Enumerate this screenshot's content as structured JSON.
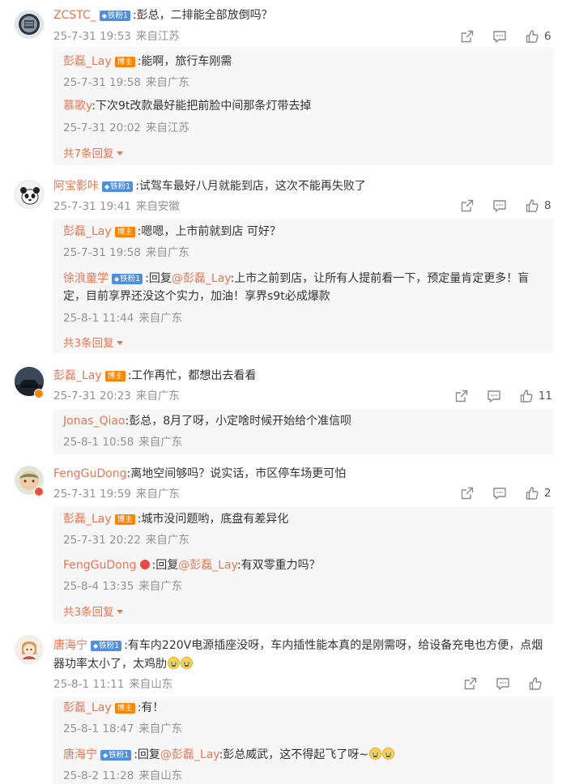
{
  "comments": [
    {
      "user": "ZCSTC_",
      "badge": "铁粉1",
      "text": ":彭总，二排能全部放倒吗？",
      "time": "25-7-31 19:53",
      "source": "来自江苏",
      "likes": "6",
      "replies": [
        {
          "user": "彭磊_Lay",
          "badge": "博主",
          "text": ":能啊，旅行车刚需",
          "time": "25-7-31 19:58",
          "source": "来自广东"
        },
        {
          "user": "慕歌y",
          "text": ":下次9t改款最好能把前脸中间那条灯带去掉",
          "time": "25-7-31 20:02",
          "source": "来自江苏"
        }
      ],
      "more": "共7条回复"
    },
    {
      "user": "阿宝影咔",
      "badge": "铁粉1",
      "text": ":试驾车最好八月就能到店，这次不能再失败了",
      "time": "25-7-31 19:41",
      "source": "来自安徽",
      "likes": "8",
      "replies": [
        {
          "user": "彭磊_Lay",
          "badge": "博主",
          "text": ":嗯嗯，上市前就到店 可好？",
          "time": "25-7-31 19:58",
          "source": "来自广东"
        },
        {
          "user": "徐浪童学",
          "badge": "铁粉1",
          "text_a": ":回复",
          "mention": "@彭磊_Lay",
          "text": ":上市之前到店，让所有人提前看一下，预定量肯定更多！盲定，目前享界还没这个实力，加油！享界s9t必成爆款",
          "time": "25-8-1 11:44",
          "source": "来自广东"
        }
      ],
      "more": "共3条回复"
    },
    {
      "user": "彭磊_Lay",
      "badge": "博主",
      "text": ":工作再忙，都想出去看看",
      "time": "25-7-31 20:23",
      "source": "来自广东",
      "likes": "11",
      "replies": [
        {
          "user": "Jonas_Qiao",
          "text": ":彭总，8月了呀，小定啥时候开始给个准信呗",
          "time": "25-8-1 10:58",
          "source": "来自广东"
        }
      ]
    },
    {
      "user": "FengGuDong",
      "text": ":离地空间够吗？说实话，市区停车场更可怕",
      "time": "25-7-31 19:59",
      "source": "来自广东",
      "likes": "2",
      "replies": [
        {
          "user": "彭磊_Lay",
          "badge": "博主",
          "text": ":城市没问题哟，底盘有差异化",
          "time": "25-7-31 20:22",
          "source": "来自广东"
        },
        {
          "user": "FengGuDong",
          "text_a": ":回复",
          "mention": "@彭磊_Lay",
          "text": ":有双零重力吗？",
          "time": "25-8-4 13:35",
          "source": "来自广东"
        }
      ],
      "more": "共3条回复"
    },
    {
      "user": "唐海宁",
      "badge": "铁粉1",
      "text": ":有车内220V电源插座没呀，车内插性能本真的是刚需呀，给设备充电也方便，点烟器功率太小了，太鸡肋",
      "time": "25-8-1 11:11",
      "source": "来自山东",
      "likes": "",
      "replies": [
        {
          "user": "彭磊_Lay",
          "badge": "博主",
          "text": ":有！",
          "time": "25-8-1 18:47",
          "source": "来自广东"
        },
        {
          "user": "唐海宁",
          "badge": "铁粉1",
          "text_a": ":回复",
          "mention": "@彭磊_Lay",
          "text": ":彭总威武，这不得起飞了呀~",
          "time": "25-8-2 11:28",
          "source": "来自山东"
        }
      ]
    }
  ],
  "icons": {
    "share": "share-icon",
    "comment": "comment-icon",
    "like": "like-icon"
  },
  "colors": {
    "username": "#eb7350",
    "meta": "#939393",
    "reply_bg": "#f7f7f7",
    "fan_badge": "#4e8fe0",
    "blogger_badge": "#ff8200"
  }
}
